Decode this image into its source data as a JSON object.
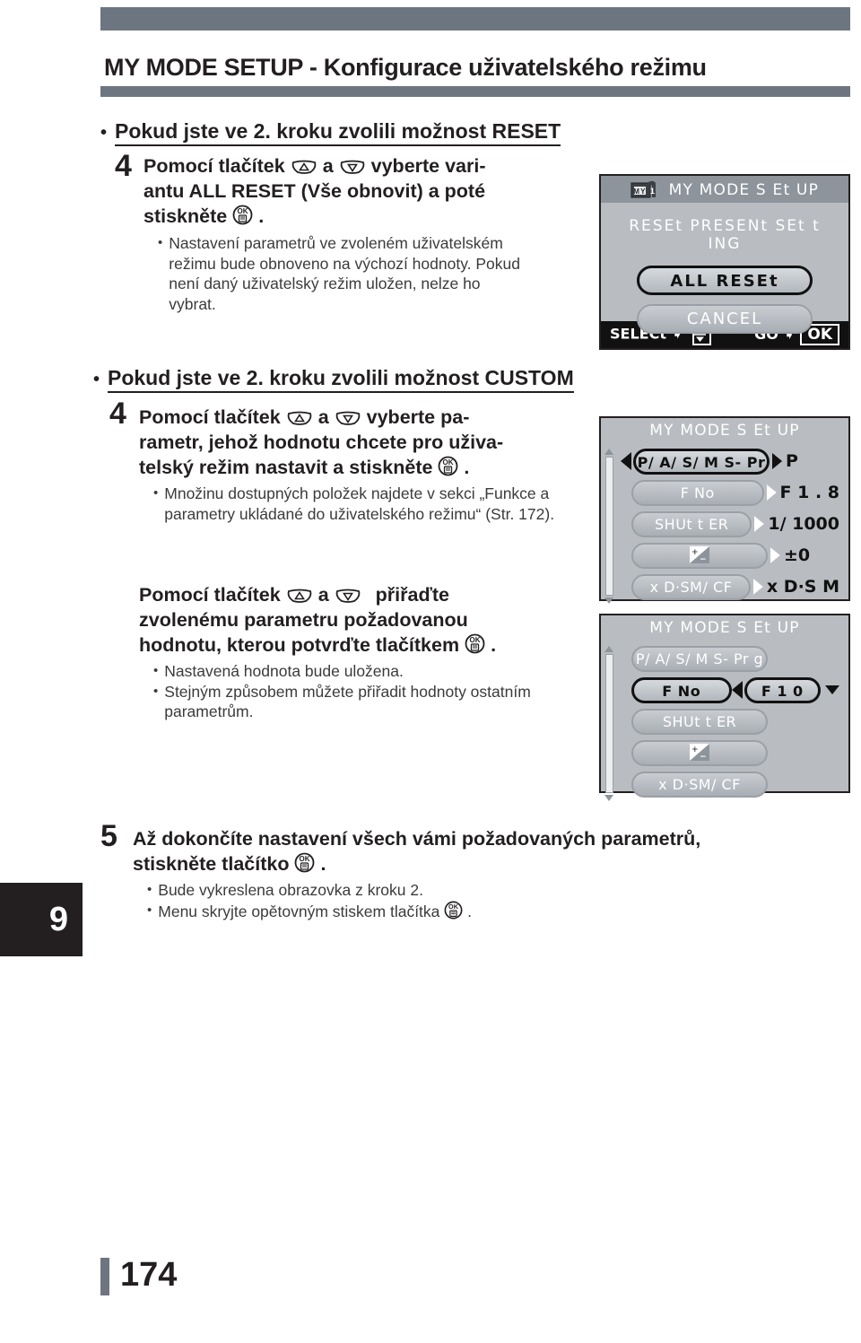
{
  "page": {
    "title": "MY MODE SETUP - Konfigurace uživatelského režimu",
    "chapter_tab": "9",
    "page_number": "174",
    "accent_color": "#6d7680",
    "lcd_bg_color": "#b9bdc2"
  },
  "sections": [
    {
      "heading": "Pokud jste ve 2. kroku zvolili možnost RESET",
      "step_number": "4",
      "step_line1": "Pomocí tlačítek",
      "step_and": "a",
      "step_line1_tail": "vyberte vari-",
      "step_line2": "antu ALL RESET (Vše obnovit) a poté",
      "step_line3": "stiskněte",
      "step_line3_tail": ".",
      "bullets": [
        "Nastavení parametrů ve zvoleném uživatelském režimu bude obnoveno na výchozí hodnoty. Pokud není daný uživatelský režim uložen, nelze ho vybrat."
      ]
    },
    {
      "heading": "Pokud jste ve 2. kroku zvolili možnost CUSTOM",
      "step_number": "4",
      "step_line1": "Pomocí tlačítek",
      "step_and": "a",
      "step_line1_tail": "vyberte pa-",
      "step_line2": "rametr, jehož hodnotu chcete pro uživa-",
      "step_line3": "telský režim nastavit a stiskněte",
      "step_line3_tail": ".",
      "bullets": [
        "Množinu dostupných položek najdete v sekci „Funkce a parametry ukládané do uživatelského režimu“ (Str. 172)."
      ],
      "step2_line1": "Pomocí tlačítek",
      "step2_and": "a",
      "step2_line1_tail": "přiřaďte",
      "step2_line2": "zvolenému parametru požadovanou",
      "step2_line3": "hodnotu, kterou potvrďte tlačítkem",
      "step2_line3_tail": ".",
      "bullets2": [
        "Nastavená hodnota bude uložena.",
        "Stejným způsobem můžete přiřadit hodnoty ostatním parametrům."
      ]
    }
  ],
  "step5": {
    "number": "5",
    "line1": "Až dokončíte nastavení všech vámi požadovaných parametrů,",
    "line2": "stiskněte tlačítko",
    "line2_tail": ".",
    "bullets": [
      {
        "before": "Bude vykreslena obrazovka z kroku 2.",
        "icon": "",
        "after": ""
      },
      {
        "before": "Menu skryjte opětovným stiskem tlačítka",
        "icon": "ok-button-icon",
        "after": "."
      }
    ]
  },
  "lcd_panels": [
    {
      "name": "reset-screen",
      "icon": "my1-mode-icon",
      "title": "MY  MODE  S Et UP",
      "subtitle": "RESEt  PRESENt  SEt t ING",
      "options": [
        {
          "label": "ALL  RESEt",
          "selected": true
        },
        {
          "label": "CANCEL",
          "selected": false
        }
      ],
      "footer_left": "SELECt",
      "footer_left_icon": "updown-icon",
      "footer_right": "GO",
      "footer_right_icon": "ok-icon",
      "footer_right_label": "OK"
    },
    {
      "name": "custom-param-list-screen",
      "title": "MY  MODE  S Et UP",
      "rows": [
        {
          "label": "P/ A/ S/ M S- Pr g",
          "value": "P",
          "selected": true,
          "left_cursor": true,
          "arrow": "solid"
        },
        {
          "label": "F No",
          "value": "F 1 . 8",
          "selected": false,
          "left_cursor": false,
          "arrow": "outline"
        },
        {
          "label": "SHUt t ER",
          "value": "1/ 1000",
          "selected": false,
          "left_cursor": false,
          "arrow": "outline"
        },
        {
          "label": "EXPOSURE-COMP-ICON",
          "value": "±0",
          "selected": false,
          "left_cursor": false,
          "arrow": "outline",
          "icon": "exposure-compensation-icon"
        },
        {
          "label": "x D·SM/ CF",
          "value": "x D·S M",
          "selected": false,
          "left_cursor": false,
          "arrow": "outline"
        }
      ]
    },
    {
      "name": "custom-value-edit-screen",
      "title": "MY  MODE  S Et UP",
      "rows": [
        {
          "label": "P/ A/ S/ M S- Pr g",
          "selected": false
        },
        {
          "label": "F No",
          "selected": true,
          "edit_value": "F 1 0"
        },
        {
          "label": "SHUt t ER",
          "selected": false
        },
        {
          "label": "EXPOSURE-COMP-ICON",
          "selected": false,
          "icon": "exposure-compensation-icon"
        },
        {
          "label": "x D·SM/ CF",
          "selected": false
        }
      ]
    }
  ]
}
